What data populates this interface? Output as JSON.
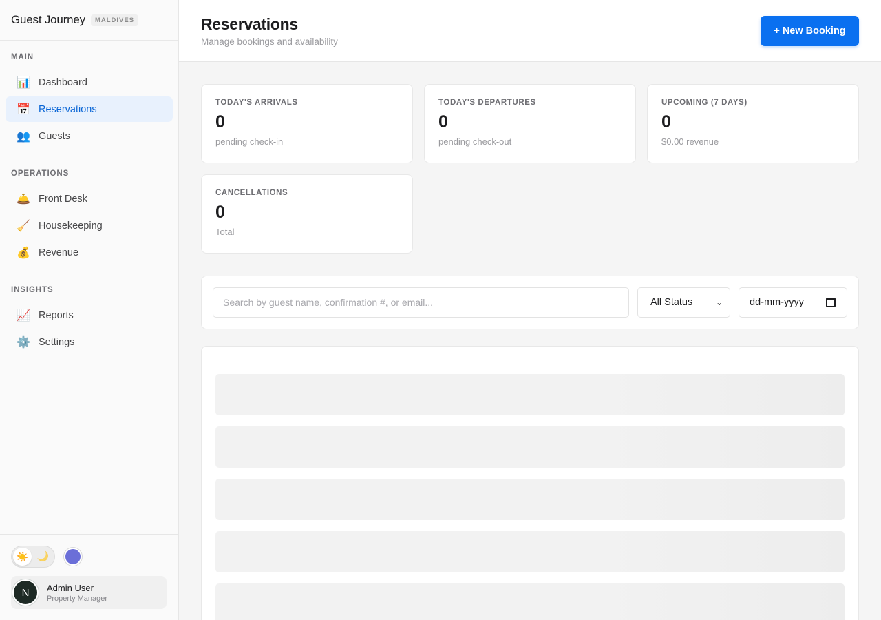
{
  "brand": {
    "name": "Guest Journey",
    "badge": "MALDIVES"
  },
  "nav": {
    "sections": [
      {
        "title": "MAIN",
        "items": [
          {
            "label": "Dashboard",
            "icon": "📊",
            "active": false
          },
          {
            "label": "Reservations",
            "icon": "📅",
            "active": true
          },
          {
            "label": "Guests",
            "icon": "👥",
            "active": false
          }
        ]
      },
      {
        "title": "OPERATIONS",
        "items": [
          {
            "label": "Front Desk",
            "icon": "🛎️",
            "active": false
          },
          {
            "label": "Housekeeping",
            "icon": "🧹",
            "active": false
          },
          {
            "label": "Revenue",
            "icon": "💰",
            "active": false
          }
        ]
      },
      {
        "title": "INSIGHTS",
        "items": [
          {
            "label": "Reports",
            "icon": "📈",
            "active": false
          },
          {
            "label": "Settings",
            "icon": "⚙️",
            "active": false
          }
        ]
      }
    ]
  },
  "footer": {
    "theme_sun": "☀️",
    "theme_moon": "🌙",
    "accent_color": "#6b6fd8",
    "user": {
      "initial": "N",
      "name": "Admin User",
      "role": "Property Manager"
    }
  },
  "header": {
    "title": "Reservations",
    "subtitle": "Manage bookings and availability",
    "new_booking_label": "+ New Booking"
  },
  "stats": [
    {
      "label": "TODAY'S ARRIVALS",
      "value": "0",
      "sub": "pending check-in"
    },
    {
      "label": "TODAY'S DEPARTURES",
      "value": "0",
      "sub": "pending check-out"
    },
    {
      "label": "UPCOMING (7 DAYS)",
      "value": "0",
      "sub": "$0.00 revenue"
    },
    {
      "label": "CANCELLATIONS",
      "value": "0",
      "sub": "Total"
    }
  ],
  "filters": {
    "search_placeholder": "Search by guest name, confirmation #, or email...",
    "status_value": "All Status",
    "date_placeholder": "dd-mm-yyyy"
  },
  "colors": {
    "accent": "#0a70f0",
    "active_nav_bg": "#e8f1fd",
    "active_nav_text": "#0a66d6"
  }
}
